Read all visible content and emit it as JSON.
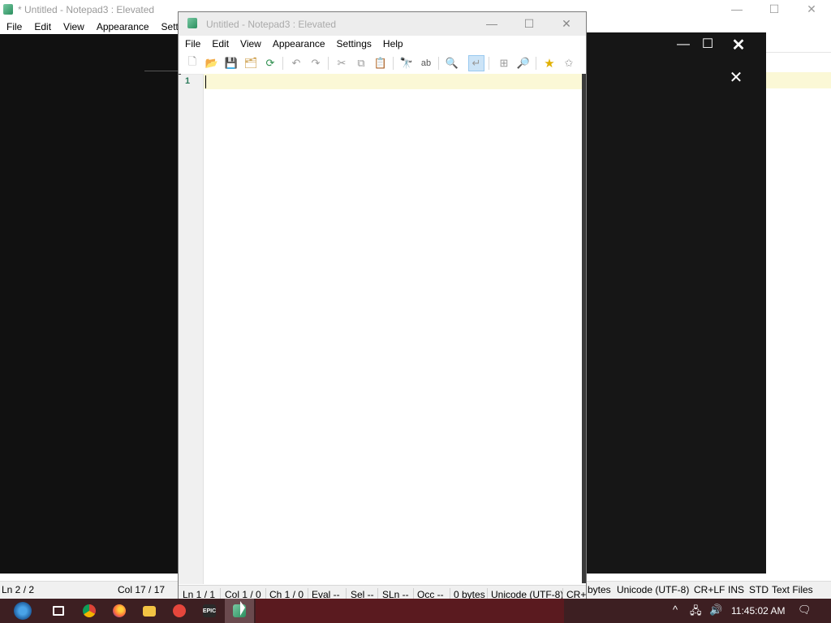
{
  "background_window": {
    "title": "* Untitled - Notepad3 : Elevated",
    "menu": [
      "File",
      "Edit",
      "View",
      "Appearance",
      "Settin"
    ],
    "status": {
      "ln": "Ln  2 / 2",
      "col": "Col  17 / 17",
      "bytes": "bytes",
      "encoding": "Unicode (UTF-8)",
      "eol": "CR+LF",
      "ins": "INS",
      "std": "STD",
      "type": "Text Files"
    },
    "caption": {
      "minimize": "—",
      "maximize": "☐",
      "close": "✕"
    }
  },
  "overlay": {
    "minimize": "—",
    "maximize": "☐",
    "close": "✕",
    "close2": "✕"
  },
  "window": {
    "title": "Untitled - Notepad3 : Elevated",
    "caption": {
      "minimize": "—",
      "maximize": "☐",
      "close": "✕"
    },
    "menu": [
      "File",
      "Edit",
      "View",
      "Appearance",
      "Settings",
      "Help"
    ],
    "toolbar": [
      {
        "name": "new-icon",
        "glyph": "🗋"
      },
      {
        "name": "open-icon",
        "glyph": "📂"
      },
      {
        "name": "save-icon",
        "glyph": "💾"
      },
      {
        "name": "save-as-icon",
        "glyph": "🗂"
      },
      {
        "name": "reload-icon",
        "glyph": "⟳"
      },
      {
        "name": "undo-icon",
        "glyph": "↶"
      },
      {
        "name": "redo-icon",
        "glyph": "↷"
      },
      {
        "name": "cut-icon",
        "glyph": "✂"
      },
      {
        "name": "copy-icon",
        "glyph": "⧉"
      },
      {
        "name": "paste-icon",
        "glyph": "📋"
      },
      {
        "name": "find-icon",
        "glyph": "🔭"
      },
      {
        "name": "replace-icon",
        "glyph": "ab"
      },
      {
        "name": "zoom-icon",
        "glyph": "🔍"
      },
      {
        "name": "word-wrap-icon",
        "glyph": "↵"
      },
      {
        "name": "split-view-icon",
        "glyph": "⊞"
      },
      {
        "name": "zoom-in-icon",
        "glyph": "🔎"
      },
      {
        "name": "favorites-icon",
        "glyph": "★"
      },
      {
        "name": "add-favorite-icon",
        "glyph": "✩"
      }
    ],
    "line_number": "1",
    "status": {
      "ln": "Ln  1 / 1",
      "col": "Col  1 / 0",
      "ch": "Ch  1 / 0",
      "eval": "Eval  --",
      "sel": "Sel  --",
      "sln": "SLn  --",
      "occ": "Occ  --",
      "bytes": "0 bytes",
      "encoding": "Unicode (UTF-8)",
      "eol": "CR+"
    }
  },
  "taskbar": {
    "apps": [
      "start",
      "task-view",
      "chrome",
      "firefox",
      "file-explorer",
      "app-red",
      "epic-games",
      "notepad3"
    ],
    "epic_label": "EPIC",
    "clock": "11:45:02 AM",
    "tray": {
      "chevron": "^",
      "network": "🖧",
      "volume": "🔊",
      "notifications": "🗨"
    }
  },
  "colors": {
    "accent_current_line": "#fbf8d6",
    "line_number": "#2b7a5a",
    "taskbar": "#3d1f22"
  }
}
